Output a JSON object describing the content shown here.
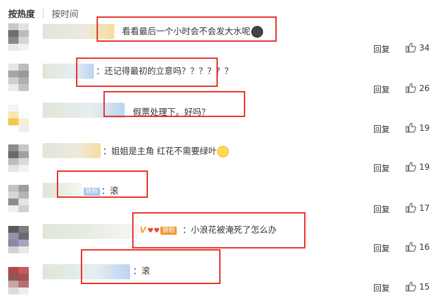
{
  "tabs": {
    "hot": "按热度",
    "time": "按时间"
  },
  "actions": {
    "reply_label": "回复"
  },
  "comments": [
    {
      "text": "看看最后一个小时会不会发大水呢",
      "likes": "34"
    },
    {
      "text": "：还记得最初的立意吗？？？？？？",
      "likes": "26"
    },
    {
      "text": "假票处理下。好吗？",
      "likes": "19"
    },
    {
      "text": "：姐姐是主角 红花不需要绿叶",
      "likes": "19"
    },
    {
      "badge": "铁粉",
      "text": "：滚",
      "likes": "17"
    },
    {
      "vmark": "V",
      "badge": "铁粉",
      "text": "：小浪花被淹死了怎么办",
      "likes": "16"
    },
    {
      "text": "：滚",
      "likes": "15"
    }
  ],
  "colors": {
    "highlight_box": "#e8332c",
    "fan_badge": "#a8c8ea",
    "fan_badge_orange": "#f19a3e"
  }
}
